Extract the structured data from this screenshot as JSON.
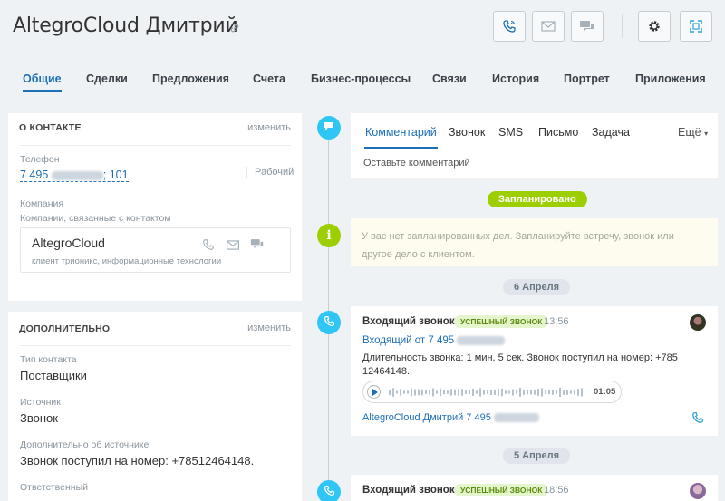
{
  "header": {
    "title": "AltegroCloud Дмитрий",
    "buttons": [
      "phone-icon",
      "envelope-icon",
      "chat-icon",
      "gear-icon",
      "expand-icon"
    ],
    "accent": "#1d6fb8"
  },
  "tabs": [
    "Общие",
    "Сделки",
    "Предложения",
    "Счета",
    "Бизнес-процессы",
    "Связи",
    "История",
    "Портрет",
    "Приложения"
  ],
  "contact_card": {
    "title": "О КОНТАКТЕ",
    "edit": "изменить",
    "phone_label": "Телефон",
    "phone_prefix": "7 495",
    "phone_masked": "000-00-00",
    "phone_suffix": "; 101",
    "phone_type": "Рабочий",
    "company_label": "Компания",
    "company_sub": "Компании, связанные с контактом",
    "company_name": "AltegroCloud",
    "company_desc": "клиент трионикс, информационные технологии"
  },
  "additional_card": {
    "title": "ДОПОЛНИТЕЛЬНО",
    "edit": "изменить",
    "fields": [
      {
        "label": "Тип контакта",
        "value": "Поставщики"
      },
      {
        "label": "Источник",
        "value": "Звонок"
      },
      {
        "label": "Дополнительно об источнике",
        "value": "Звонок поступил на номер: +78512464148."
      },
      {
        "label": "Ответственный",
        "value": ""
      }
    ]
  },
  "editor": {
    "tabs": [
      "Комментарий",
      "Звонок",
      "SMS",
      "Письмо",
      "Задача"
    ],
    "more": "Ещё",
    "placeholder": "Оставьте комментарий"
  },
  "timeline": {
    "planned_label": "Запланировано",
    "planned_text": "У вас нет запланированных дел. Запланируйте встречу, звонок или другое дело с клиентом.",
    "date1": "6 Апреля",
    "date2": "5 Апреля",
    "colors": {
      "blue": "#2fc6f6",
      "green": "#9dcf00"
    }
  },
  "call1": {
    "title": "Входящий звонок",
    "badge": "УСПЕШНЫЙ ЗВОНОК",
    "time": "13:56",
    "link_prefix": "Входящий от 7 495",
    "link_masked": "000-00-00",
    "duration": "Длительность звонка: 1 мин, 5 сек. Звонок поступил на номер: +785 12464148.",
    "player_time": "01:05",
    "contact_prefix": "AltegroCloud Дмитрий 7 495",
    "contact_masked": "000-00-00"
  },
  "call2": {
    "title": "Входящий звонок",
    "badge": "УСПЕШНЫЙ ЗВОНОК",
    "time": "18:56"
  }
}
